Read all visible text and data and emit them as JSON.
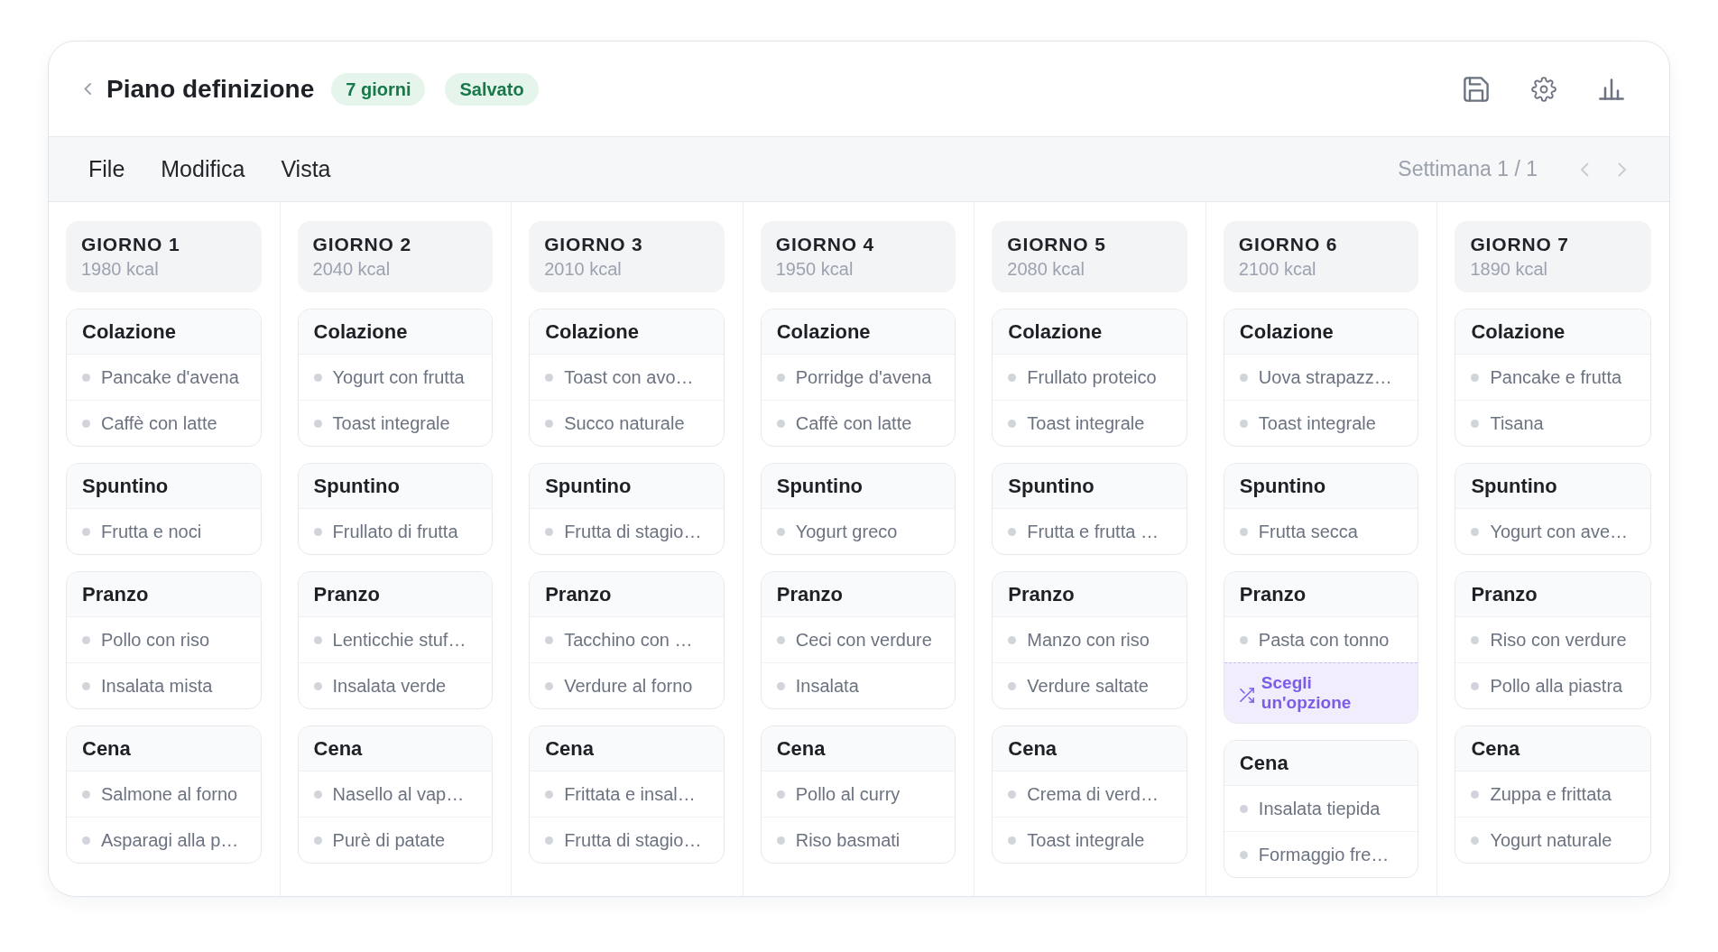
{
  "header": {
    "title": "Piano definizione",
    "tags": [
      "7 giorni",
      "Salvato"
    ]
  },
  "menu": {
    "items": [
      "File",
      "Modifica",
      "Vista"
    ],
    "week_label": "Settimana 1 / 1"
  },
  "days": [
    {
      "title": "GIORNO 1",
      "kcal": "1980 kcal",
      "meals": [
        {
          "name": "Colazione",
          "items": [
            {
              "kind": "food",
              "text": "Pancake d'avena"
            },
            {
              "kind": "food",
              "text": "Caffè con latte"
            }
          ]
        },
        {
          "name": "Spuntino",
          "items": [
            {
              "kind": "food",
              "text": "Frutta e noci"
            }
          ]
        },
        {
          "name": "Pranzo",
          "items": [
            {
              "kind": "food",
              "text": "Pollo con riso"
            },
            {
              "kind": "food",
              "text": "Insalata mista"
            }
          ]
        },
        {
          "name": "Cena",
          "items": [
            {
              "kind": "food",
              "text": "Salmone al forno"
            },
            {
              "kind": "food",
              "text": "Asparagi alla p…"
            }
          ]
        }
      ]
    },
    {
      "title": "GIORNO 2",
      "kcal": "2040 kcal",
      "meals": [
        {
          "name": "Colazione",
          "items": [
            {
              "kind": "food",
              "text": "Yogurt con frutta"
            },
            {
              "kind": "food",
              "text": "Toast integrale"
            }
          ]
        },
        {
          "name": "Spuntino",
          "items": [
            {
              "kind": "food",
              "text": "Frullato di frutta"
            }
          ]
        },
        {
          "name": "Pranzo",
          "items": [
            {
              "kind": "food",
              "text": "Lenticchie stuf…"
            },
            {
              "kind": "food",
              "text": "Insalata verde"
            }
          ]
        },
        {
          "name": "Cena",
          "items": [
            {
              "kind": "food",
              "text": "Nasello al vap…"
            },
            {
              "kind": "food",
              "text": "Purè di patate"
            }
          ]
        }
      ]
    },
    {
      "title": "GIORNO 3",
      "kcal": "2010 kcal",
      "meals": [
        {
          "name": "Colazione",
          "items": [
            {
              "kind": "food",
              "text": "Toast con avo…"
            },
            {
              "kind": "food",
              "text": "Succo naturale"
            }
          ]
        },
        {
          "name": "Spuntino",
          "items": [
            {
              "kind": "food",
              "text": "Frutta di stagio…"
            }
          ]
        },
        {
          "name": "Pranzo",
          "items": [
            {
              "kind": "food",
              "text": "Tacchino con …"
            },
            {
              "kind": "food",
              "text": "Verdure al forno"
            }
          ]
        },
        {
          "name": "Cena",
          "items": [
            {
              "kind": "food",
              "text": "Frittata e insal…"
            },
            {
              "kind": "food",
              "text": "Frutta di stagio…"
            }
          ]
        }
      ]
    },
    {
      "title": "GIORNO 4",
      "kcal": "1950 kcal",
      "meals": [
        {
          "name": "Colazione",
          "items": [
            {
              "kind": "food",
              "text": "Porridge d'avena"
            },
            {
              "kind": "food",
              "text": "Caffè con latte"
            }
          ]
        },
        {
          "name": "Spuntino",
          "items": [
            {
              "kind": "food",
              "text": "Yogurt greco"
            }
          ]
        },
        {
          "name": "Pranzo",
          "items": [
            {
              "kind": "food",
              "text": "Ceci con verdure"
            },
            {
              "kind": "food",
              "text": "Insalata"
            }
          ]
        },
        {
          "name": "Cena",
          "items": [
            {
              "kind": "food",
              "text": "Pollo al curry"
            },
            {
              "kind": "food",
              "text": "Riso basmati"
            }
          ]
        }
      ]
    },
    {
      "title": "GIORNO 5",
      "kcal": "2080 kcal",
      "meals": [
        {
          "name": "Colazione",
          "items": [
            {
              "kind": "food",
              "text": "Frullato proteico"
            },
            {
              "kind": "food",
              "text": "Toast integrale"
            }
          ]
        },
        {
          "name": "Spuntino",
          "items": [
            {
              "kind": "food",
              "text": "Frutta e frutta …"
            }
          ]
        },
        {
          "name": "Pranzo",
          "items": [
            {
              "kind": "food",
              "text": "Manzo con riso"
            },
            {
              "kind": "food",
              "text": "Verdure saltate"
            }
          ]
        },
        {
          "name": "Cena",
          "items": [
            {
              "kind": "food",
              "text": "Crema di verd…"
            },
            {
              "kind": "food",
              "text": "Toast integrale"
            }
          ]
        }
      ]
    },
    {
      "title": "GIORNO 6",
      "kcal": "2100 kcal",
      "meals": [
        {
          "name": "Colazione",
          "items": [
            {
              "kind": "food",
              "text": "Uova strapazz…"
            },
            {
              "kind": "food",
              "text": "Toast integrale"
            }
          ]
        },
        {
          "name": "Spuntino",
          "items": [
            {
              "kind": "food",
              "text": "Frutta secca"
            }
          ]
        },
        {
          "name": "Pranzo",
          "items": [
            {
              "kind": "food",
              "text": "Pasta con tonno"
            },
            {
              "kind": "choice",
              "text": "Scegli un'opzione"
            }
          ]
        },
        {
          "name": "Cena",
          "items": [
            {
              "kind": "food",
              "text": "Insalata tiepida"
            },
            {
              "kind": "food",
              "text": "Formaggio fre…"
            }
          ]
        }
      ]
    },
    {
      "title": "GIORNO 7",
      "kcal": "1890 kcal",
      "meals": [
        {
          "name": "Colazione",
          "items": [
            {
              "kind": "food",
              "text": "Pancake e frutta"
            },
            {
              "kind": "food",
              "text": "Tisana"
            }
          ]
        },
        {
          "name": "Spuntino",
          "items": [
            {
              "kind": "food",
              "text": "Yogurt con ave…"
            }
          ]
        },
        {
          "name": "Pranzo",
          "items": [
            {
              "kind": "food",
              "text": "Riso con verdure"
            },
            {
              "kind": "food",
              "text": "Pollo alla piastra"
            }
          ]
        },
        {
          "name": "Cena",
          "items": [
            {
              "kind": "food",
              "text": "Zuppa e frittata"
            },
            {
              "kind": "food",
              "text": "Yogurt naturale"
            }
          ]
        }
      ]
    }
  ]
}
